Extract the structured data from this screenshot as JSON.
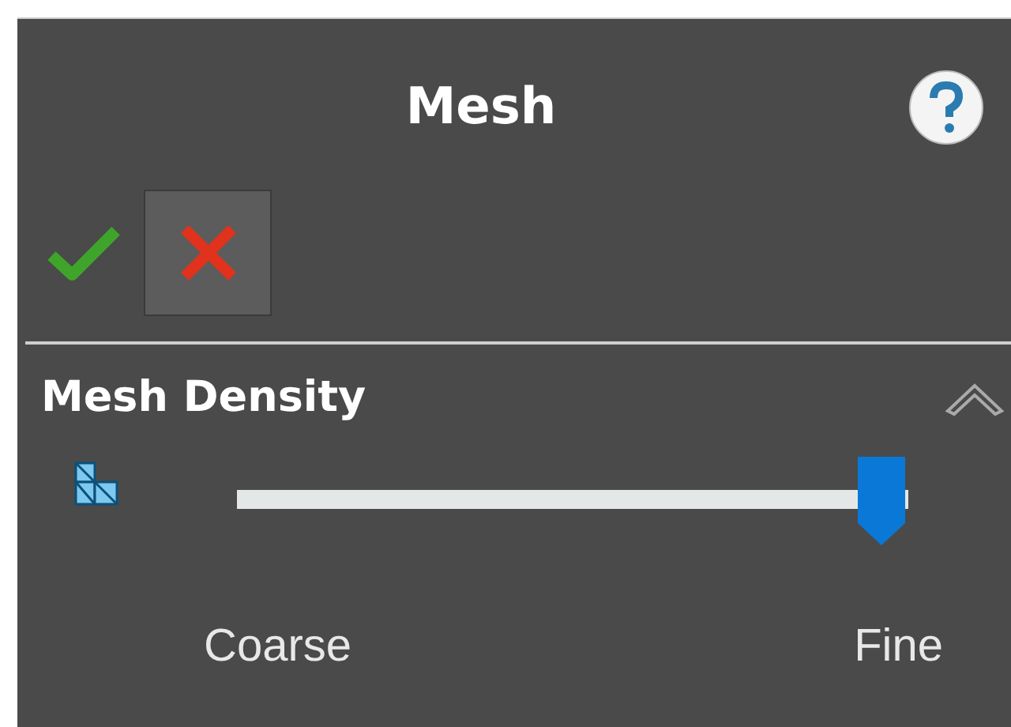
{
  "panel": {
    "title": "Mesh"
  },
  "actions": [
    {
      "kind": "ok"
    },
    {
      "kind": "cancel"
    }
  ],
  "section": {
    "title": "Mesh Density",
    "expanded": true,
    "slider": {
      "level": 0.96,
      "min_label": "Coarse",
      "max_label": "Fine"
    }
  }
}
